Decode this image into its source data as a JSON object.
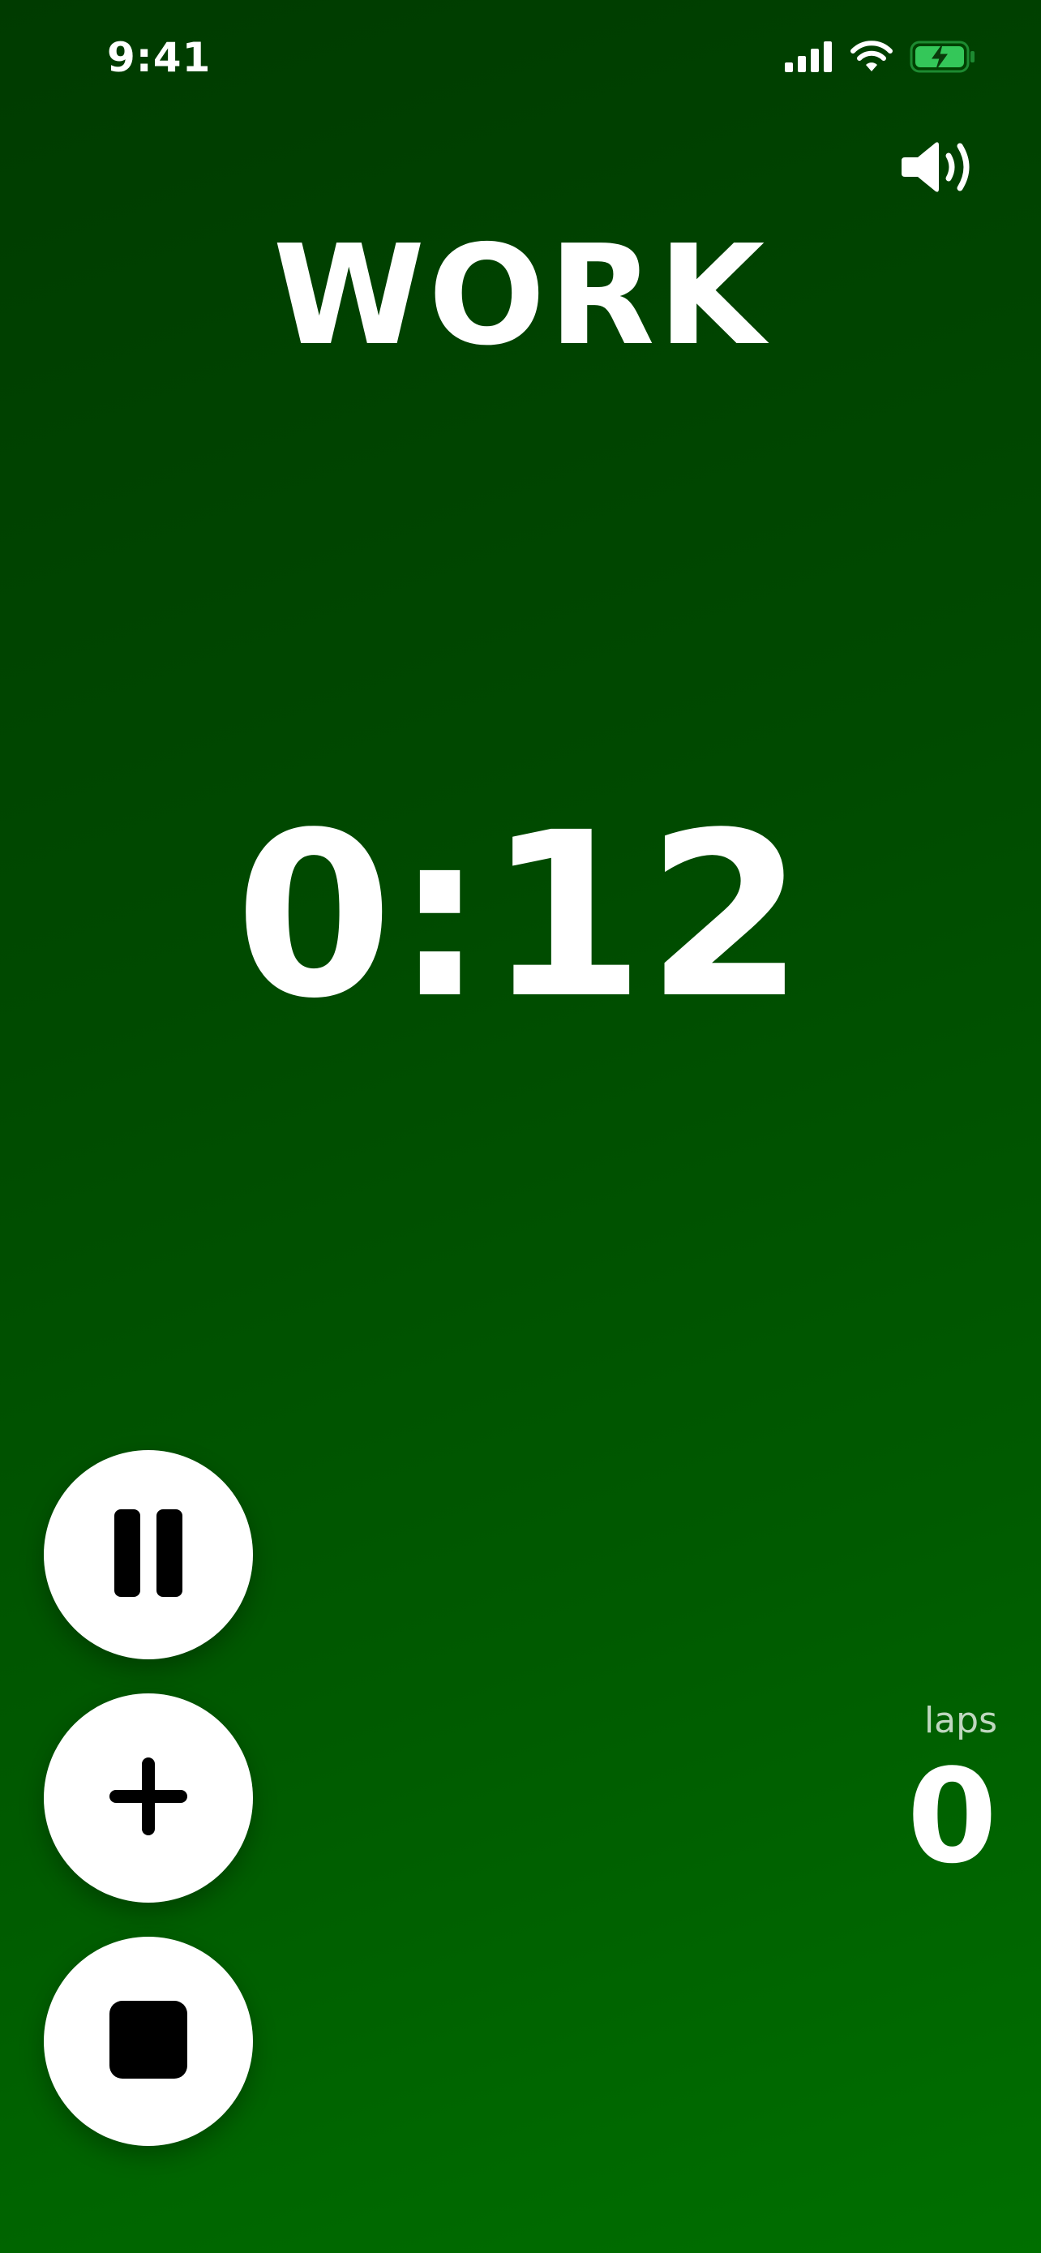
{
  "status_bar": {
    "time": "9:41",
    "icons": [
      "cellular-signal-icon",
      "wifi-icon",
      "battery-charging-icon"
    ],
    "battery_color": "#34c759"
  },
  "header": {
    "sound_icon": "speaker-volume-icon",
    "phase_title": "WORK"
  },
  "timer": {
    "display": "0:12"
  },
  "controls": {
    "pause_icon": "pause-icon",
    "add_icon": "plus-icon",
    "stop_icon": "stop-icon"
  },
  "laps": {
    "label": "laps",
    "count": "0"
  },
  "colors": {
    "background_top": "#003b00",
    "background_bottom": "#006f00",
    "button_bg": "#ffffff",
    "icon_color": "#000000",
    "text_color": "#ffffff"
  }
}
